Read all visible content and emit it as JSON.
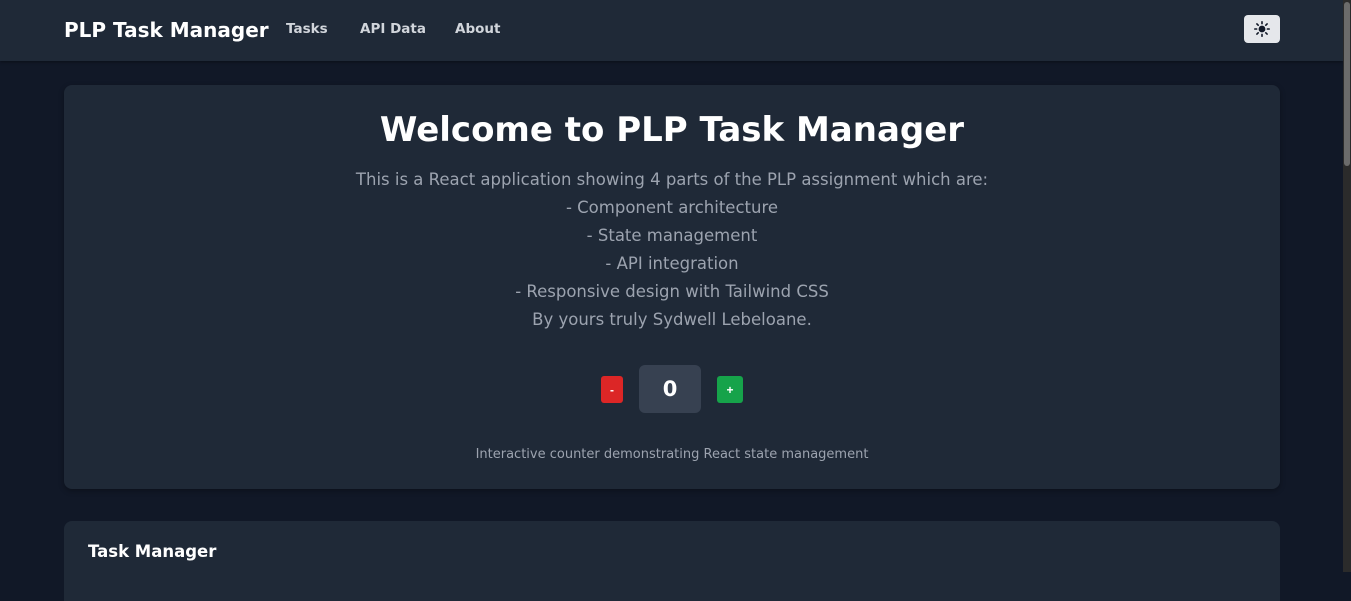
{
  "navbar": {
    "brand": "PLP Task Manager",
    "links": [
      "Tasks",
      "API Data",
      "About"
    ],
    "theme_toggle_icon": "sun-icon"
  },
  "hero": {
    "title": "Welcome to PLP Task Manager",
    "description_lines": [
      "This is a React application showing 4 parts of the PLP assignment which are:",
      "- Component architecture",
      "- State management",
      "- API integration",
      "- Responsive design with Tailwind CSS",
      "By yours truly Sydwell Lebeloane."
    ],
    "counter": {
      "decrement_label": "-",
      "value": "0",
      "increment_label": "+"
    },
    "caption": "Interactive counter demonstrating React state management"
  },
  "task_section": {
    "title": "Task Manager"
  },
  "colors": {
    "page_bg": "#111827",
    "card_bg": "#1f2937",
    "decrement": "#dc2626",
    "increment": "#16a34a",
    "counter_bg": "#374151"
  }
}
